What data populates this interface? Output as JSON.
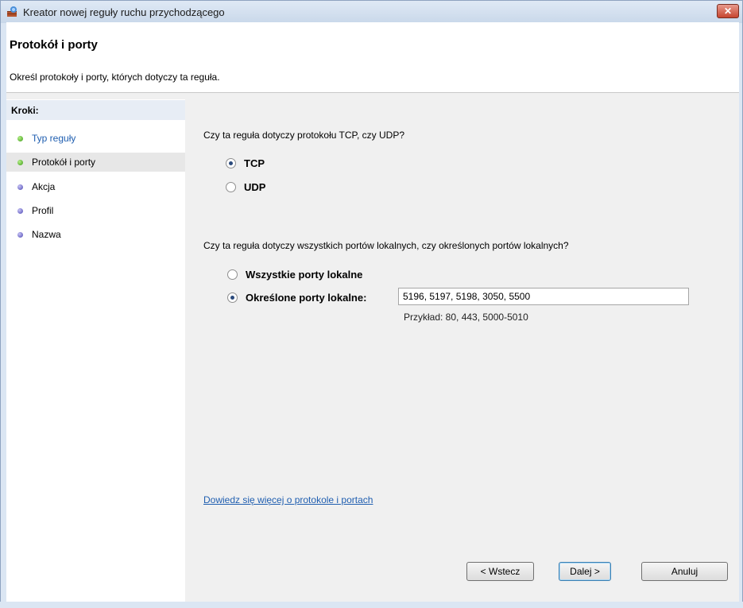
{
  "window": {
    "title": "Kreator nowej reguły ruchu przychodzącego",
    "close_symbol": "✕"
  },
  "header": {
    "title": "Protokół i porty",
    "subtitle": "Określ protokoły i porty, których dotyczy ta reguła."
  },
  "sidebar": {
    "heading": "Kroki:",
    "steps": [
      {
        "label": "Typ reguły",
        "status": "done",
        "dot_color": "#3b9a14",
        "link": true
      },
      {
        "label": "Protokół i porty",
        "status": "current",
        "dot_color": "#3b9a14",
        "link": false
      },
      {
        "label": "Akcja",
        "status": "pending",
        "dot_color": "#4a45b3",
        "link": false
      },
      {
        "label": "Profil",
        "status": "pending",
        "dot_color": "#4a45b3",
        "link": false
      },
      {
        "label": "Nazwa",
        "status": "pending",
        "dot_color": "#4a45b3",
        "link": false
      }
    ]
  },
  "protocol": {
    "question": "Czy ta reguła dotyczy protokołu TCP, czy UDP?",
    "options": [
      {
        "label": "TCP",
        "checked": true
      },
      {
        "label": "UDP",
        "checked": false
      }
    ]
  },
  "ports": {
    "question": "Czy ta reguła dotyczy wszystkich portów lokalnych, czy określonych portów lokalnych?",
    "all_label": "Wszystkie porty lokalne",
    "all_checked": false,
    "specific_label": "Określone porty lokalne:",
    "specific_checked": true,
    "value": "5196, 5197, 5198, 3050, 5500",
    "example": "Przykład: 80, 443, 5000-5010"
  },
  "learn_more": "Dowiedz się więcej o protokole i portach",
  "buttons": {
    "back": "< Wstecz",
    "next": "Dalej >",
    "cancel": "Anuluj"
  },
  "colors": {
    "link": "#1f5eb0",
    "titlebar": "#c9d8ea",
    "close": "#c6452f"
  }
}
